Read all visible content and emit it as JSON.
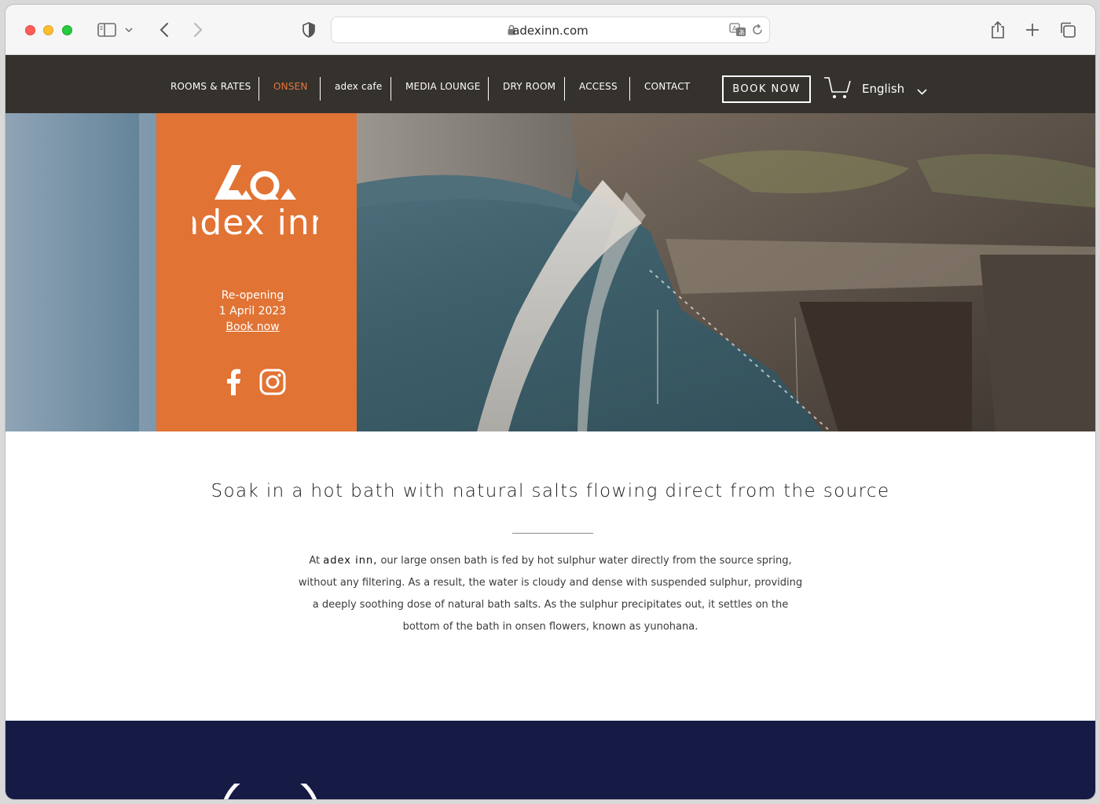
{
  "browser": {
    "url": "adexinn.com"
  },
  "nav": {
    "items": [
      {
        "label": "ROOMS & RATES",
        "active": false
      },
      {
        "label": "ONSEN",
        "active": true
      },
      {
        "label": "adex cafe",
        "active": false
      },
      {
        "label": "MEDIA LOUNGE",
        "active": false
      },
      {
        "label": "DRY ROOM",
        "active": false
      },
      {
        "label": "ACCESS",
        "active": false
      },
      {
        "label": "CONTACT",
        "active": false
      }
    ],
    "book_label": "BOOK NOW",
    "language": "English"
  },
  "hero": {
    "logo_text": "adex inn",
    "reopen_line1": "Re-opening",
    "reopen_line2": "1 April 2023",
    "book_link": "Book now"
  },
  "content": {
    "headline": "Soak in a hot bath with natural salts flowing direct from the source",
    "p1_prefix": "At ",
    "p1_brand": "adex inn,",
    "p1_rest": " our large onsen bath is fed by hot sulphur water directly from the source spring,",
    "p2": "without any filtering. As a result, the water is cloudy and dense with suspended sulphur, providing",
    "p3": "a deeply soothing dose of natural bath salts. As the sulphur precipitates out, it settles on the",
    "p4": "bottom of the bath in onsen flowers, known as yunohana."
  },
  "colors": {
    "nav_bg": "#35312d",
    "accent_orange": "#e17334",
    "active_nav": "#e5763c",
    "footer_navy": "#161b45"
  },
  "icons": [
    "sidebar-icon",
    "chevron-down-icon",
    "back-icon",
    "forward-icon",
    "shield-icon",
    "lock-icon",
    "translate-icon",
    "reload-icon",
    "share-icon",
    "new-tab-icon",
    "tabs-overview-icon",
    "cart-icon",
    "facebook-icon",
    "instagram-icon"
  ]
}
